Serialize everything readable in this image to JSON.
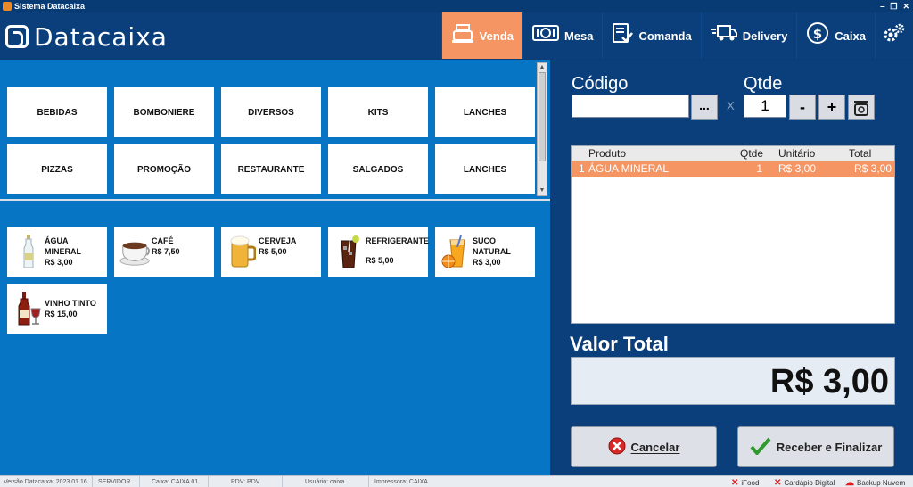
{
  "window": {
    "title": "Sistema Datacaixa",
    "controls": [
      "‒",
      "❐",
      "✕"
    ]
  },
  "brand": {
    "logo_text": "Datacaixa"
  },
  "nav": {
    "items": [
      {
        "label": "Venda",
        "icon": "cash-register-icon",
        "active": true
      },
      {
        "label": "Mesa",
        "icon": "table-icon",
        "active": false
      },
      {
        "label": "Comanda",
        "icon": "checklist-icon",
        "active": false
      },
      {
        "label": "Delivery",
        "icon": "truck-icon",
        "active": false
      },
      {
        "label": "Caixa",
        "icon": "dollar-icon",
        "active": false
      }
    ],
    "settings_icon": "gear-icon",
    "active_color": "#f59563"
  },
  "categories": [
    "BEBIDAS",
    "BOMBONIERE",
    "DIVERSOS",
    "KITS",
    "LANCHES",
    "PIZZAS",
    "PROMOÇÃO",
    "RESTAURANTE",
    "SALGADOS",
    "LANCHES"
  ],
  "products": [
    {
      "name": "ÁGUA MINERAL",
      "price": "R$ 3,00",
      "icon": "water-bottle-icon"
    },
    {
      "name": "CAFÉ",
      "price": "R$ 7,50",
      "icon": "coffee-cup-icon"
    },
    {
      "name": "CERVEJA",
      "price": "R$ 5,00",
      "icon": "beer-mug-icon"
    },
    {
      "name": "REFRIGERANTE",
      "price": "R$ 5,00",
      "icon": "soda-glass-icon"
    },
    {
      "name": "SUCO NATURAL",
      "price": "R$ 3,00",
      "icon": "juice-glass-icon"
    },
    {
      "name": "VINHO TINTO",
      "price": "R$ 15,00",
      "icon": "wine-bottle-icon"
    }
  ],
  "sale": {
    "code_label": "Código",
    "code_value": "",
    "browse_label": "...",
    "x_label": "X",
    "qty_label": "Qtde",
    "qty_value": "1",
    "minus_label": "-",
    "plus_label": "+",
    "scale_icon": "scale-icon",
    "grid": {
      "headers": {
        "product": "Produto",
        "qty": "Qtde",
        "unit": "Unitário",
        "total": "Total"
      },
      "rows": [
        {
          "index": "1",
          "product": "ÁGUA MINERAL",
          "qty": "1",
          "unit": "R$ 3,00",
          "total": "R$ 3,00"
        }
      ]
    },
    "total_label": "Valor Total",
    "total_value": "R$ 3,00",
    "cancel_label": "Cancelar",
    "finish_label": "Receber e Finalizar"
  },
  "statusbar": {
    "version": "Versão Datacaixa: 2023.01.16",
    "server": "SERVIDOR",
    "register": "Caixa: CAIXA 01",
    "pdv": "PDV: PDV",
    "user": "Usuário: caixa",
    "printer": "Impressora: CAIXA",
    "ifood": "iFood",
    "menu": "Cardápio Digital",
    "backup": "Backup Nuvem"
  }
}
